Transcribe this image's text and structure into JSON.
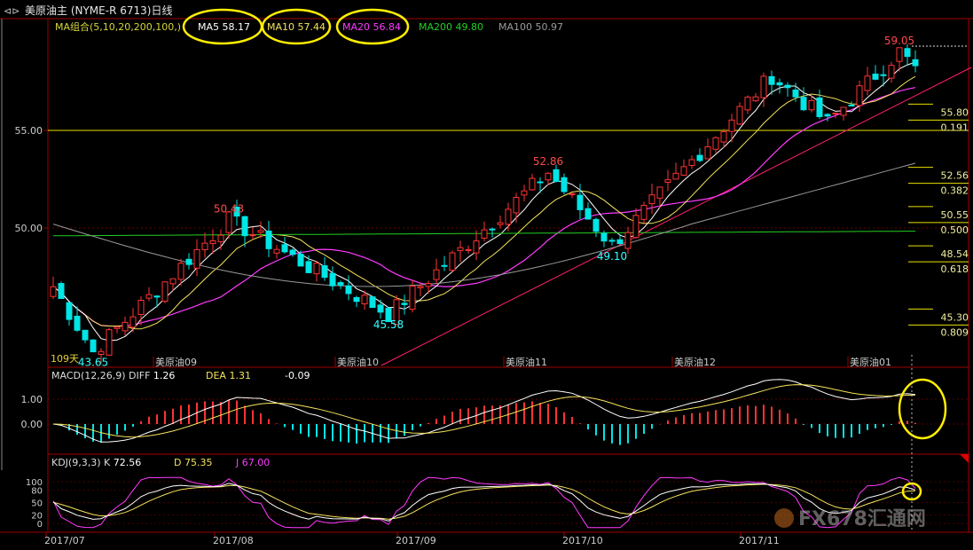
{
  "window": {
    "title": "美原油主 (NYME-R 6713)日线",
    "icon": "nav-arrows-icon"
  },
  "price_panel": {
    "ma_group": "MA组合(5,10,20,200,100,)",
    "ma_labels": [
      {
        "name": "MA5",
        "value": "58.17",
        "color": "#ffffff"
      },
      {
        "name": "MA10",
        "value": "57.44",
        "color": "#f5e35a"
      },
      {
        "name": "MA20",
        "value": "56.84",
        "color": "#ff3bff"
      },
      {
        "name": "MA200",
        "value": "49.80",
        "color": "#22d022"
      },
      {
        "name": "MA100",
        "value": "50.97",
        "color": "#9a9a9a"
      }
    ],
    "y_ticks": [
      "55.00",
      "50.00"
    ],
    "y_tick_values": [
      55,
      50
    ],
    "range_label": "109天",
    "annotations": [
      {
        "text": "50.43",
        "color": "#ff4a4a",
        "price": 50.43
      },
      {
        "text": "52.86",
        "color": "#ff4a4a",
        "price": 52.86
      },
      {
        "text": "59.05",
        "color": "#ff4a4a",
        "price": 59.05
      },
      {
        "text": "43.65",
        "color": "#33ffff",
        "price": 43.65
      },
      {
        "text": "45.58",
        "color": "#33ffff",
        "price": 45.58
      },
      {
        "text": "49.10",
        "color": "#33ffff",
        "price": 49.1
      }
    ],
    "contract_labels": [
      "美原油09",
      "美原油10",
      "美原油11",
      "美原油12",
      "美原油01"
    ],
    "fib_levels": [
      {
        "price": "55.80",
        "ratio": "0.191"
      },
      {
        "price": "52.56",
        "ratio": "0.382"
      },
      {
        "price": "50.55",
        "ratio": "0.500"
      },
      {
        "price": "48.54",
        "ratio": "0.618"
      },
      {
        "price": "45.30",
        "ratio": "0.809"
      }
    ]
  },
  "macd_panel": {
    "title": "MACD(12,26,9)",
    "diff_label": "DIFF",
    "diff_value": "1.26",
    "dea_label": "DEA",
    "dea_value": "1.31",
    "macd_value": "-0.09",
    "y_ticks": [
      "1.00",
      "0.00"
    ]
  },
  "kdj_panel": {
    "title": "KDJ(9,3,3)",
    "k_label": "K",
    "k_value": "72.56",
    "d_label": "D",
    "d_value": "75.35",
    "j_label": "J",
    "j_value": "67.00",
    "y_ticks": [
      "100",
      "80",
      "50",
      "20",
      "0"
    ]
  },
  "x_axis": {
    "labels": [
      "2017/07",
      "2017/08",
      "2017/09",
      "2017/10",
      "2017/11"
    ]
  },
  "watermark": "FX678汇通网",
  "colors": {
    "up": "#ff3333",
    "down": "#00e5e5",
    "axis": "#a00000",
    "fib": "#e8e000",
    "trend": "#ff1e6e",
    "ma5": "#ffffff",
    "ma10": "#f5e35a",
    "ma20": "#ff3bff",
    "ma200": "#22d022",
    "ma100": "#9a9a9a",
    "highlight": "#ffee00"
  },
  "chart_data": {
    "type": "candlestick",
    "title": "美原油主 (NYME-R 6713)日线",
    "bars": 109,
    "y_range": [
      42.5,
      60.5
    ],
    "x_labels": [
      "2017/07",
      "2017/08",
      "2017/09",
      "2017/10",
      "2017/11"
    ],
    "key_points": [
      {
        "label": "43.65",
        "type": "low",
        "price": 43.65
      },
      {
        "label": "50.43",
        "type": "high",
        "price": 50.43
      },
      {
        "label": "45.58",
        "type": "low",
        "price": 45.58
      },
      {
        "label": "52.86",
        "type": "high",
        "price": 52.86
      },
      {
        "label": "49.10",
        "type": "low",
        "price": 49.1
      },
      {
        "label": "59.05",
        "type": "high",
        "price": 59.05
      }
    ],
    "moving_averages": {
      "MA5": 58.17,
      "MA10": 57.44,
      "MA20": 56.84,
      "MA200": 49.8,
      "MA100": 50.97
    },
    "fibonacci": [
      {
        "ratio": 0.191,
        "price": 55.8
      },
      {
        "ratio": 0.382,
        "price": 52.56
      },
      {
        "ratio": 0.5,
        "price": 50.55
      },
      {
        "ratio": 0.618,
        "price": 48.54
      },
      {
        "ratio": 0.809,
        "price": 45.3
      }
    ],
    "macd": {
      "diff": 1.26,
      "dea": 1.31,
      "macd": -0.09
    },
    "kdj": {
      "k": 72.56,
      "d": 75.35,
      "j": 67.0
    }
  }
}
